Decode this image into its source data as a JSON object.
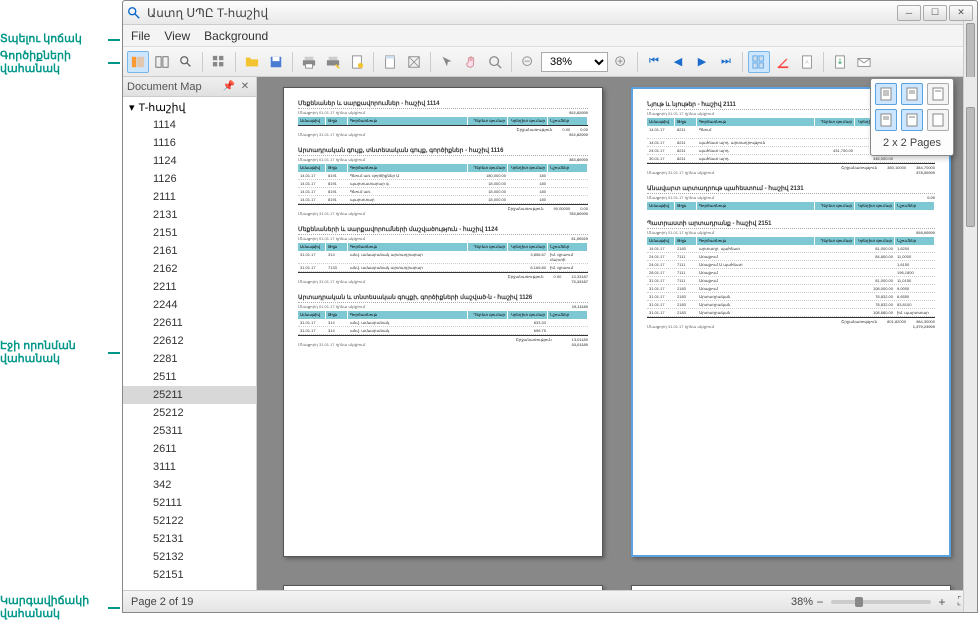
{
  "window_title": "Աստղ ՍՊԸ T-հաշիվ",
  "menubar": {
    "file": "File",
    "view": "View",
    "background": "Background"
  },
  "zoom_value": "38%",
  "docmap": {
    "title": "Document Map",
    "root": "T-հաշիվ",
    "items": [
      "1114",
      "1116",
      "1124",
      "1126",
      "2111",
      "2131",
      "2151",
      "2161",
      "2162",
      "2211",
      "2244",
      "22611",
      "22612",
      "2281",
      "2511",
      "25211",
      "25212",
      "25311",
      "2611",
      "3111",
      "342",
      "52111",
      "52122",
      "52131",
      "52132",
      "52151"
    ],
    "selected": "25211"
  },
  "pages_popup": {
    "label": "2 x 2 Pages"
  },
  "status": {
    "page": "Page 2 of 19",
    "zoom": "38%"
  },
  "report": {
    "p1": {
      "sections": [
        {
          "title": "Մեքենաներ և սարքավորումներ - հաշիվ 1114",
          "opening_label": "Մնացորդ 01.01.17 դրնա սկզբում",
          "opening": "922,82000",
          "total_label": "Շրջանառություն",
          "debit": "0.00",
          "credit": "0.00",
          "closing_label": "Մնացորդ 31.01.17 դրնա սկզբում",
          "closing": "922,82000"
        },
        {
          "title": "Արտադրական գույք, տնտեսական գույք, գործիքներ - հաշիվ 1116",
          "opening_label": "Մնացորդ 01.01.17 դրնա սկզբում",
          "opening": "383,80000",
          "rows": [
            {
              "date": "14.01.17",
              "code": "8191",
              "desc": "Գնում առ. գործիքներ Ա",
              "amt1": "180,000.00",
              "amt2": "180"
            },
            {
              "date": "14.01.17",
              "code": "8191",
              "desc": "պարտատարար գ.",
              "amt1": "18,000.00",
              "amt2": "180"
            },
            {
              "date": "14.01.17",
              "code": "8191",
              "desc": "Գնում առ.",
              "amt1": "18,000.00",
              "amt2": "180"
            },
            {
              "date": "14.01.17",
              "code": "8191",
              "desc": "պարտտար",
              "amt1": "18,000.00",
              "amt2": "180"
            }
          ],
          "total_label": "Շրջանառություն",
          "debit": "90,00000",
          "credit": "0.00",
          "closing_label": "Մնացորդ 31.01.17 դրնա սկզբում",
          "closing": "783,80000"
        },
        {
          "title": "Մեքենաների և սարքավորումների մաշվածություն - հաշիվ 1124",
          "opening_label": "Մնացորդ 01.01.17 դրնա սկզբում",
          "opening": "61,00020",
          "rows": [
            {
              "date": "31.01.17",
              "code": "314",
              "desc": "անվ. ամսաբանակ արտադրաբար",
              "amt1": "",
              "amt2": "3,856.67",
              "note": "իմ. գրաում մարտի"
            },
            {
              "date": "31.01.17",
              "code": "7133",
              "desc": "անվ. ամսաբանակ արտադրաբար",
              "amt1": "",
              "amt2": "8,166.80",
              "note": "իմ. գրաում"
            }
          ],
          "total_label": "Շրջանառություն",
          "debit": "0.00",
          "credit": "13,33187",
          "closing_label": "Մնացորդ 31.01.17 դրնա սկզբում",
          "closing": "73,33187"
        },
        {
          "title": "Արտադրական և տնտեսական գույքի, գործիքների մաշված-ն - հաշիվ 1126",
          "opening_label": "Մնացորդ 01.01.17 դրնա սկզբում",
          "opening": "19,11180",
          "rows": [
            {
              "date": "31.01.17",
              "code": "314",
              "desc": "անվ. ամսաբանակ",
              "amt1": "",
              "amt2": "833.33"
            },
            {
              "date": "31.01.17",
              "code": "314",
              "desc": "անվ. ամսաբանակ",
              "amt1": "",
              "amt2": "696.75"
            }
          ],
          "total_label": "Շրջանառություն",
          "debit": "",
          "credit": "13,01180",
          "closing_label": "Մնացորդ 31.01.17 դրնա սկզբում",
          "closing": "33,01180"
        }
      ]
    },
    "p2": {
      "sections": [
        {
          "title": "Նյութ և նյութեր - հաշիվ 2111",
          "opening_label": "Մնացորդ 01.01.17 դրնա սկզբում",
          "opening": "0.00",
          "rows": [
            {
              "date": "14.01.17",
              "code": "8211",
              "desc": "Գնում",
              "amt1": "",
              "amt2": "",
              "note": "մատակարար Կ/09.01.2018"
            },
            {
              "date": "14.01.17",
              "code": "8211",
              "desc": "պահեստ արդ. արտադրություն",
              "amt1": "",
              "amt2": "",
              "note": "14.01.2018"
            },
            {
              "date": "24.01.17",
              "code": "8211",
              "desc": "պահեստ արդ.",
              "amt1": "431,700.00",
              "amt2": "",
              "note": ""
            },
            {
              "date": "30.01.17",
              "code": "8211",
              "desc": "պահեստ արդ.",
              "amt1": "",
              "amt2": "346,000.00",
              "note": ""
            }
          ],
          "total_label": "Շրջանառություն",
          "debit": "380,10000",
          "credit": "384,70000",
          "closing_label": "Մնացորդ 31.01.17 դրնա սկզբում",
          "closing": "378,30000"
        },
        {
          "title": "Անավարտ արտադրութ պահեստում - հաշիվ 2131",
          "opening_label": "Մնացորդ 01.01.17 դրնա սկզբում",
          "opening": "0.00"
        },
        {
          "title": "Պատրաստի արտադրանք - հաշիվ 2151",
          "opening_label": "Մնացորդ 01.01.17 դրնա սկզբում",
          "opening": "928,00000",
          "rows": [
            {
              "date": "14.01.17",
              "code": "2183",
              "desc": "արտադր. պահեստ",
              "amt1": "",
              "amt2": "81,000.00",
              "note": "1,6200"
            },
            {
              "date": "24.01.17",
              "code": "7111",
              "desc": "Առաքում",
              "amt1": "",
              "amt2": "84,800.00",
              "note": "11,0000"
            },
            {
              "date": "24.01.17",
              "code": "7111",
              "desc": "Առաքում Ա պահեստ",
              "amt1": "",
              "amt2": "",
              "note": "1,6150"
            },
            {
              "date": "28.01.17",
              "code": "7111",
              "desc": "Առաքում",
              "amt1": "",
              "amt2": "",
              "note": "196,1800"
            },
            {
              "date": "31.01.17",
              "code": "7111",
              "desc": "Առաքում",
              "amt1": "",
              "amt2": "81,000.00",
              "note": "11,0150"
            },
            {
              "date": "31.01.17",
              "code": "2183",
              "desc": "Առաքում",
              "amt1": "",
              "amt2": "108,000.00",
              "note": "9,0000"
            },
            {
              "date": "31.01.17",
              "code": "2183",
              "desc": "Արտադրական",
              "amt1": "",
              "amt2": "78,832.00",
              "note": "6,6550"
            },
            {
              "date": "31.01.17",
              "code": "2183",
              "desc": "Արտադրական",
              "amt1": "",
              "amt2": "78,832.00",
              "note": "83,8100"
            },
            {
              "date": "31.01.17",
              "code": "2183",
              "desc": "Արտադրական",
              "amt1": "",
              "amt2": "108,680.00",
              "note": "իմ. պարտտար"
            }
          ],
          "total_label": "Շրջանառություն",
          "debit": "801,82000",
          "credit": "984,30000",
          "closing_label": "Մնացորդ 31.01.17 դրնա սկզբում",
          "closing": "1,379,23000"
        }
      ]
    }
  },
  "annotations": {
    "a1": "Տպելու կոճակ",
    "a2": "Գործիքների վահանակ",
    "a3": "Էջի որոնման վահանակ",
    "a4": "Կարգավիճակի վահանակ"
  }
}
